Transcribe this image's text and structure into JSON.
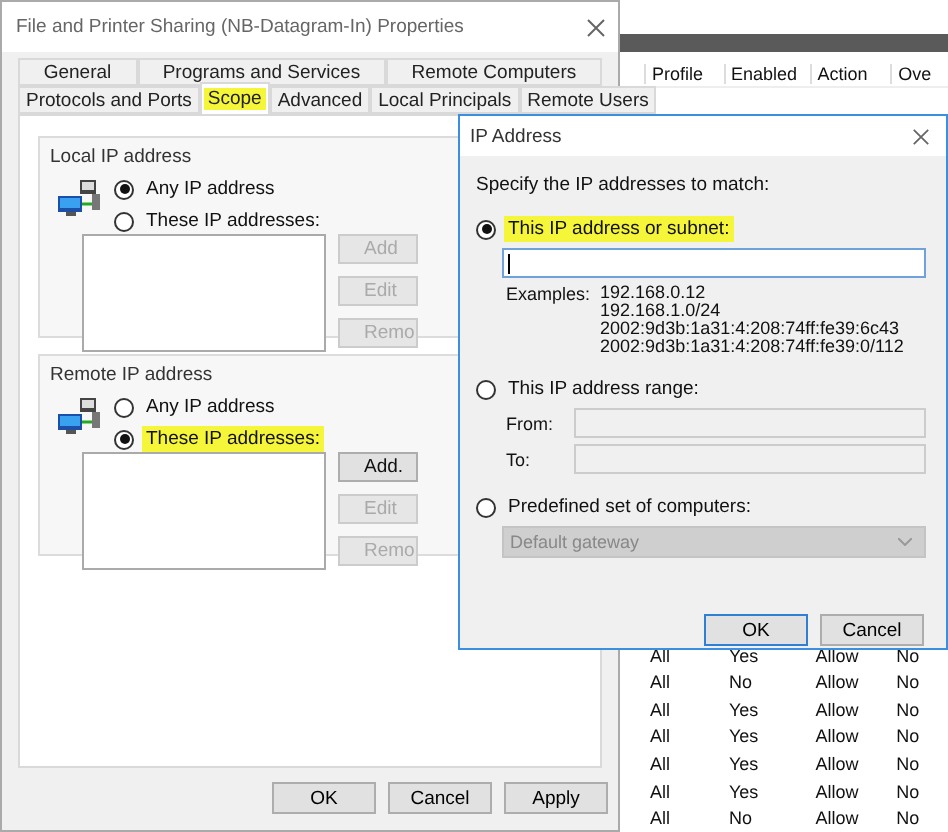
{
  "background_list": {
    "columns": [
      "Profile",
      "Enabled",
      "Action",
      "Ove"
    ],
    "rows": [
      [
        "All",
        "Yes",
        "Allow",
        "No"
      ],
      [
        "All",
        "No",
        "Allow",
        "No"
      ],
      [
        "All",
        "Yes",
        "Allow",
        "No"
      ],
      [
        "All",
        "Yes",
        "Allow",
        "No"
      ],
      [
        "All",
        "Yes",
        "Allow",
        "No"
      ],
      [
        "All",
        "Yes",
        "Allow",
        "No"
      ],
      [
        "All",
        "No",
        "Allow",
        "No"
      ]
    ]
  },
  "properties": {
    "title": "File and Printer Sharing (NB-Datagram-In) Properties",
    "tab_rows": [
      [
        {
          "label": "General",
          "selected": false,
          "highlighted": false
        },
        {
          "label": "Programs and Services",
          "selected": false,
          "highlighted": false
        },
        {
          "label": "Remote Computers",
          "selected": false,
          "highlighted": false
        }
      ],
      [
        {
          "label": "Protocols and Ports",
          "selected": false,
          "highlighted": false
        },
        {
          "label": "Scope",
          "selected": true,
          "highlighted": true
        },
        {
          "label": "Advanced",
          "selected": false,
          "highlighted": false
        },
        {
          "label": "Local Principals",
          "selected": false,
          "highlighted": false
        },
        {
          "label": "Remote Users",
          "selected": false,
          "highlighted": false
        }
      ]
    ],
    "groups": [
      {
        "title": "Local IP address",
        "options": [
          {
            "label": "Any IP address",
            "selected": true,
            "highlighted": false
          },
          {
            "label": "These IP addresses:",
            "selected": false,
            "highlighted": false
          }
        ],
        "buttons": [
          {
            "label": "Add",
            "disabled": true
          },
          {
            "label": "Edit",
            "disabled": true
          },
          {
            "label": "Remo",
            "disabled": true
          }
        ]
      },
      {
        "title": "Remote IP address",
        "options": [
          {
            "label": "Any IP address",
            "selected": false,
            "highlighted": false
          },
          {
            "label": "These IP addresses:",
            "selected": true,
            "highlighted": true
          }
        ],
        "buttons": [
          {
            "label": "Add.",
            "disabled": false
          },
          {
            "label": "Edit",
            "disabled": true
          },
          {
            "label": "Remo",
            "disabled": true
          }
        ]
      }
    ],
    "footer_buttons": [
      {
        "label": "OK"
      },
      {
        "label": "Cancel"
      },
      {
        "label": "Apply"
      }
    ]
  },
  "ip_dialog": {
    "title": "IP Address",
    "prompt": "Specify the IP addresses to match:",
    "options": [
      {
        "kind": "subnet",
        "label": "This IP address or subnet:",
        "selected": true,
        "highlighted": true,
        "examples_label": "Examples:",
        "examples": [
          "192.168.0.12",
          "192.168.1.0/24",
          "2002:9d3b:1a31:4:208:74ff:fe39:6c43",
          "2002:9d3b:1a31:4:208:74ff:fe39:0/112"
        ]
      },
      {
        "kind": "range",
        "label": "This IP address range:",
        "selected": false,
        "highlighted": false,
        "from_label": "From:",
        "to_label": "To:"
      },
      {
        "kind": "predefined",
        "label": "Predefined set of computers:",
        "selected": false,
        "highlighted": false,
        "dropdown": "Default gateway"
      }
    ],
    "buttons": [
      {
        "label": "OK",
        "default": true
      },
      {
        "label": "Cancel",
        "default": false
      }
    ]
  }
}
